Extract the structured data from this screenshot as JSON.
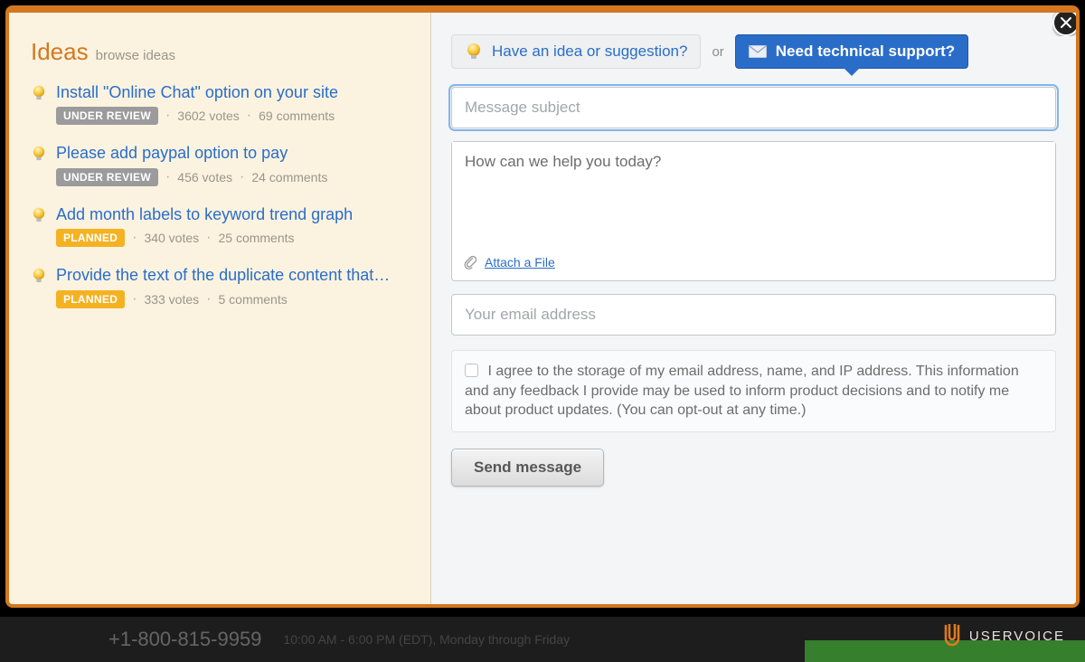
{
  "sidebar": {
    "title": "Ideas",
    "browse_label": "browse ideas",
    "items": [
      {
        "title": "Install \"Online Chat\" option on your site",
        "status_label": "UNDER REVIEW",
        "status_class": "underreview",
        "votes": "3602 votes",
        "comments": "69 comments"
      },
      {
        "title": "Please add paypal option to pay",
        "status_label": "UNDER REVIEW",
        "status_class": "underreview",
        "votes": "456 votes",
        "comments": "24 comments"
      },
      {
        "title": "Add month labels to keyword trend graph",
        "status_label": "PLANNED",
        "status_class": "planned",
        "votes": "340 votes",
        "comments": "25 comments"
      },
      {
        "title": "Provide the text of the duplicate content that…",
        "status_label": "PLANNED",
        "status_class": "planned",
        "votes": "333 votes",
        "comments": "5 comments"
      }
    ]
  },
  "top": {
    "idea_label": "Have an idea or suggestion?",
    "or_label": "or",
    "support_label": "Need technical support?"
  },
  "form": {
    "subject_placeholder": "Message subject",
    "body_placeholder": "How can we help you today?",
    "attach_label": "Attach a File",
    "email_placeholder": "Your email address",
    "consent_text": "I agree to the storage of my email address, name, and IP address. This information and any feedback I provide may be used to inform product decisions and to notify me about product updates. (You can opt-out at any time.)",
    "send_label": "Send message"
  },
  "footer": {
    "phone": "+1-800-815-9959",
    "hours": "10:00 AM - 6:00 PM (EDT), Monday through Friday",
    "brand": "USERVOICE"
  }
}
